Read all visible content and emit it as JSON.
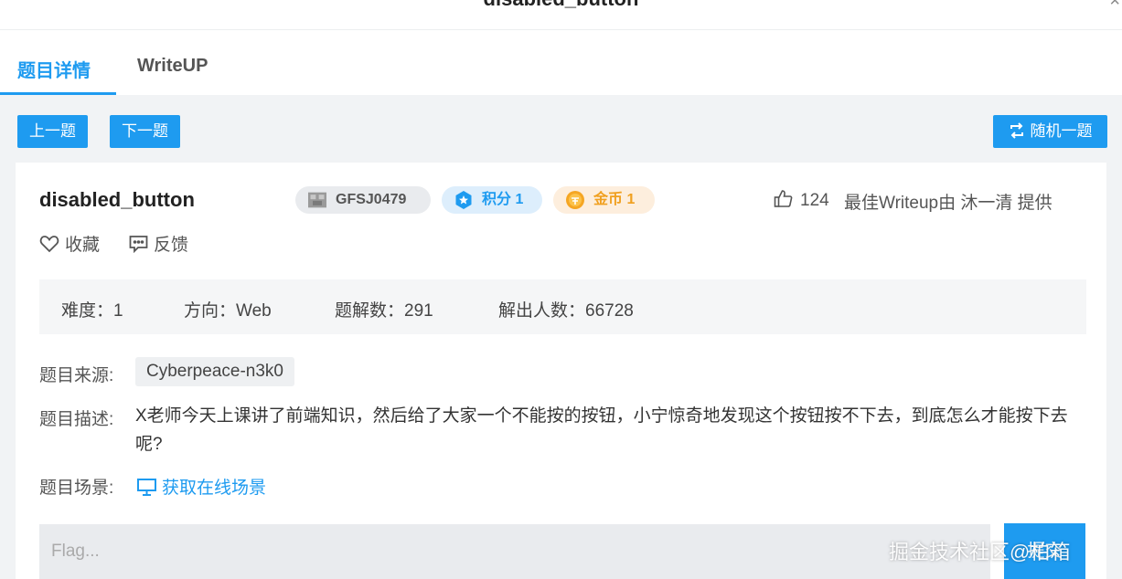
{
  "window": {
    "title": "disabled_button",
    "close_glyph": "×"
  },
  "tabs": [
    {
      "label": "题目详情",
      "active": true
    },
    {
      "label": "WriteUP",
      "active": false
    }
  ],
  "nav": {
    "prev": "上一题",
    "next": "下一题",
    "random": "随机一题"
  },
  "problem": {
    "title": "disabled_button",
    "author": "GFSJ0479",
    "points": "积分 1",
    "coins": "金币 1",
    "likes": "124",
    "best_writeup": "最佳Writeup由 沐一清 提供",
    "favorite": "收藏",
    "feedback": "反馈"
  },
  "stats": {
    "difficulty": "难度：1",
    "direction": "方向：Web",
    "solves": "题解数：291",
    "solvers": "解出人数：66728"
  },
  "meta": {
    "source_label": "题目来源:",
    "source_value": "Cyberpeace-n3k0",
    "desc_label": "题目描述:",
    "desc_value": "X老师今天上课讲了前端知识，然后给了大家一个不能按的按钮，小宁惊奇地发现这个按钮按不下去，到底怎么才能按下去呢?",
    "scene_label": "题目场景:",
    "scene_link": "获取在线场景"
  },
  "flag": {
    "placeholder": "Flag...",
    "submit": "提交"
  },
  "watermark": "掘金技术社区@柏箱",
  "colors": {
    "accent": "#1e9bf0",
    "coin": "#f0a020",
    "background": "#f1f3f5"
  },
  "icons": [
    "close-icon",
    "refresh-icon",
    "author-avatar-icon",
    "star-badge-icon",
    "coin-icon",
    "thumbs-up-icon",
    "heart-icon",
    "comment-icon",
    "monitor-icon"
  ]
}
